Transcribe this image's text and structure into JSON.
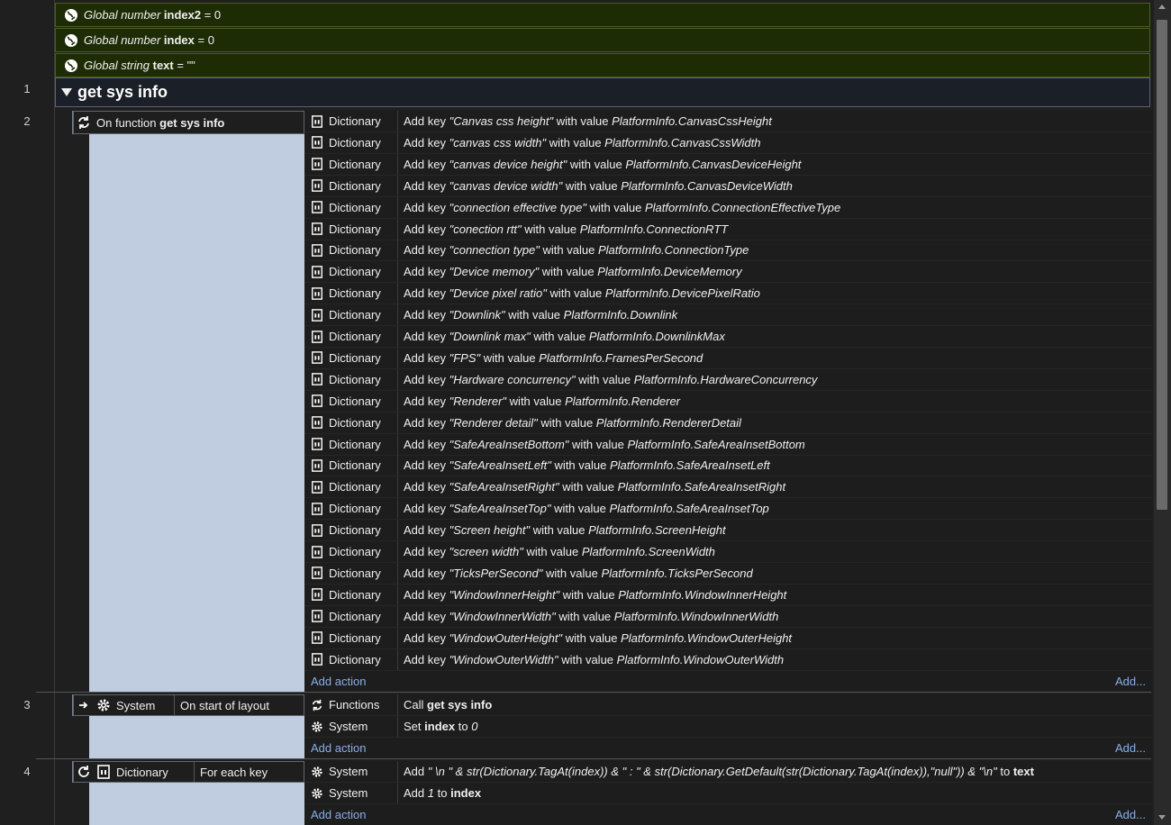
{
  "globals": [
    {
      "type_label": "Global number",
      "name": "index2",
      "value": "= 0"
    },
    {
      "type_label": "Global number",
      "name": "index",
      "value": "= 0"
    },
    {
      "type_label": "Global string",
      "name": "text",
      "value": "= \"\""
    }
  ],
  "rownums": [
    "1",
    "2",
    "3",
    "4"
  ],
  "group": {
    "title": "get sys info"
  },
  "event2": {
    "trigger_prefix": "On function",
    "trigger_name": "get sys info",
    "actions": [
      {
        "obj": "Dictionary",
        "key": "\"Canvas css height\"",
        "val": "PlatformInfo.CanvasCssHeight"
      },
      {
        "obj": "Dictionary",
        "key": "\"canvas css width\"",
        "val": "PlatformInfo.CanvasCssWidth"
      },
      {
        "obj": "Dictionary",
        "key": "\"canvas device height\"",
        "val": "PlatformInfo.CanvasDeviceHeight"
      },
      {
        "obj": "Dictionary",
        "key": "\"canvas device width\"",
        "val": "PlatformInfo.CanvasDeviceWidth"
      },
      {
        "obj": "Dictionary",
        "key": "\"connection effective type\"",
        "val": "PlatformInfo.ConnectionEffectiveType"
      },
      {
        "obj": "Dictionary",
        "key": "\"conection rtt\"",
        "val": "PlatformInfo.ConnectionRTT"
      },
      {
        "obj": "Dictionary",
        "key": "\"connection type\"",
        "val": "PlatformInfo.ConnectionType"
      },
      {
        "obj": "Dictionary",
        "key": "\"Device memory\"",
        "val": "PlatformInfo.DeviceMemory"
      },
      {
        "obj": "Dictionary",
        "key": "\"Device pixel ratio\"",
        "val": "PlatformInfo.DevicePixelRatio"
      },
      {
        "obj": "Dictionary",
        "key": "\"Downlink\"",
        "val": "PlatformInfo.Downlink"
      },
      {
        "obj": "Dictionary",
        "key": "\"Downlink max\"",
        "val": "PlatformInfo.DownlinkMax"
      },
      {
        "obj": "Dictionary",
        "key": "\"FPS\"",
        "val": "PlatformInfo.FramesPerSecond"
      },
      {
        "obj": "Dictionary",
        "key": "\"Hardware concurrency\"",
        "val": "PlatformInfo.HardwareConcurrency"
      },
      {
        "obj": "Dictionary",
        "key": "\"Renderer\"",
        "val": "PlatformInfo.Renderer"
      },
      {
        "obj": "Dictionary",
        "key": "\"Renderer detail\"",
        "val": "PlatformInfo.RendererDetail"
      },
      {
        "obj": "Dictionary",
        "key": "\"SafeAreaInsetBottom\"",
        "val": "PlatformInfo.SafeAreaInsetBottom"
      },
      {
        "obj": "Dictionary",
        "key": "\"SafeAreaInsetLeft\"",
        "val": "PlatformInfo.SafeAreaInsetLeft"
      },
      {
        "obj": "Dictionary",
        "key": "\"SafeAreaInsetRight\"",
        "val": "PlatformInfo.SafeAreaInsetRight"
      },
      {
        "obj": "Dictionary",
        "key": "\"SafeAreaInsetTop\"",
        "val": "PlatformInfo.SafeAreaInsetTop"
      },
      {
        "obj": "Dictionary",
        "key": "\"Screen height\"",
        "val": "PlatformInfo.ScreenHeight"
      },
      {
        "obj": "Dictionary",
        "key": "\"screen width\"",
        "val": "PlatformInfo.ScreenWidth"
      },
      {
        "obj": "Dictionary",
        "key": "\"TicksPerSecond\"",
        "val": "PlatformInfo.TicksPerSecond"
      },
      {
        "obj": "Dictionary",
        "key": "\"WindowInnerHeight\"",
        "val": "PlatformInfo.WindowInnerHeight"
      },
      {
        "obj": "Dictionary",
        "key": "\"WindowInnerWidth\"",
        "val": "PlatformInfo.WindowInnerWidth"
      },
      {
        "obj": "Dictionary",
        "key": "\"WindowOuterHeight\"",
        "val": "PlatformInfo.WindowOuterHeight"
      },
      {
        "obj": "Dictionary",
        "key": "\"WindowOuterWidth\"",
        "val": "PlatformInfo.WindowOuterWidth"
      }
    ]
  },
  "event3": {
    "trigger_obj": "System",
    "trigger_cond": "On start of layout",
    "actions": [
      {
        "obj": "Functions",
        "pre": "Call",
        "bold": "get sys info",
        "post": "",
        "ital": ""
      },
      {
        "obj": "System",
        "pre": "Set",
        "bold": "index",
        "post": "to",
        "ital": "0"
      }
    ]
  },
  "event4": {
    "trigger_obj": "Dictionary",
    "trigger_cond": "For each key",
    "actions": [
      {
        "obj": "System",
        "pre": "Add",
        "expr": "\" \\n \" & str(Dictionary.TagAt(index)) & \" : \" & str(Dictionary.GetDefault(str(Dictionary.TagAt(index)),\"null\")) & \"\\n\"",
        "post": "to",
        "bold": "text"
      },
      {
        "obj": "System",
        "pre": "Add",
        "expr": "1",
        "post": "to",
        "bold": "index"
      }
    ]
  },
  "labels": {
    "add_action": "Add action",
    "add_more": "Add...",
    "with_value": "with value",
    "add_key": "Add key"
  },
  "colors": {
    "global_bg": "#1e2c06",
    "condition_fill": "#c0cde0",
    "link": "#89aee8"
  }
}
